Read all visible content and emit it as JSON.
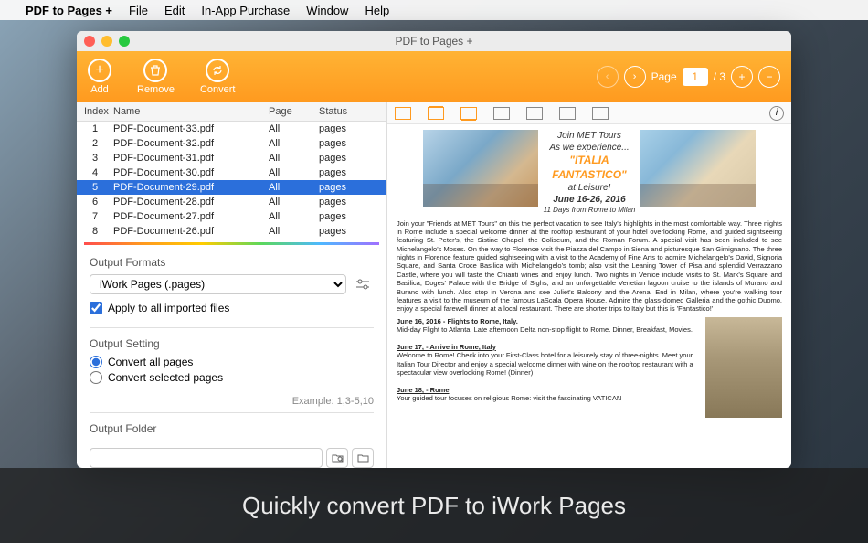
{
  "menubar": {
    "app": "PDF to Pages +",
    "items": [
      "File",
      "Edit",
      "In-App Purchase",
      "Window",
      "Help"
    ]
  },
  "window": {
    "title": "PDF to Pages +"
  },
  "toolbar": {
    "add": "Add",
    "remove": "Remove",
    "convert": "Convert"
  },
  "page_nav": {
    "label": "Page",
    "current": "1",
    "total": "/ 3"
  },
  "table": {
    "headers": {
      "index": "Index",
      "name": "Name",
      "page": "Page",
      "status": "Status"
    },
    "rows": [
      {
        "idx": "1",
        "name": "PDF-Document-33.pdf",
        "page": "All",
        "status": "pages"
      },
      {
        "idx": "2",
        "name": "PDF-Document-32.pdf",
        "page": "All",
        "status": "pages"
      },
      {
        "idx": "3",
        "name": "PDF-Document-31.pdf",
        "page": "All",
        "status": "pages"
      },
      {
        "idx": "4",
        "name": "PDF-Document-30.pdf",
        "page": "All",
        "status": "pages"
      },
      {
        "idx": "5",
        "name": "PDF-Document-29.pdf",
        "page": "All",
        "status": "pages"
      },
      {
        "idx": "6",
        "name": "PDF-Document-28.pdf",
        "page": "All",
        "status": "pages"
      },
      {
        "idx": "7",
        "name": "PDF-Document-27.pdf",
        "page": "All",
        "status": "pages"
      },
      {
        "idx": "8",
        "name": "PDF-Document-26.pdf",
        "page": "All",
        "status": "pages"
      }
    ],
    "selected": 4
  },
  "output_formats": {
    "title": "Output Formats",
    "selected": "iWork Pages (.pages)",
    "apply_all": "Apply to all imported files"
  },
  "output_setting": {
    "title": "Output Setting",
    "all": "Convert all pages",
    "selected": "Convert selected pages",
    "example": "Example: 1,3-5,10"
  },
  "output_folder": {
    "title": "Output Folder"
  },
  "preview": {
    "join": "Join MET Tours",
    "exp": "As we experience...",
    "italia": "\"ITALIA",
    "fantastico": "FANTASTICO\"",
    "leisure": "at Leisure!",
    "dates": "June 16-26, 2016",
    "days": "11 Days from Rome to Milan",
    "intro": "Join your \"Friends at MET Tours\" on this the perfect vacation to see Italy's highlights in the most comfortable way. Three nights in Rome include a special welcome dinner at the rooftop restaurant of your hotel overlooking Rome, and guided sightseeing featuring St. Peter's, the Sistine Chapel, the Coliseum, and the Roman Forum. A special visit has been included to see Michelangelo's Moses. On the way to Florence visit the Piazza del Campo in Siena and picturesque San Gimignano. The three nights in Florence feature guided sightseeing with a visit to the Academy of Fine Arts to admire Michelangelo's David, Signoria Square, and Santa Croce Basilica with Michelangelo's tomb; also visit the Leaning Tower of Pisa and splendid Verrazzano Castle, where you will taste the Chianti wines and enjoy lunch. Two nights in Venice include visits to St. Mark's Square and Basilica, Doges' Palace with the Bridge of Sighs, and an unforgettable Venetian lagoon cruise to the islands of Murano and Burano with lunch. Also stop in Verona and see Juliet's Balcony and the Arena. End in Milan, where you're walking tour features a visit to the museum of the famous LaScala Opera House. Admire the glass-domed Galleria and the gothic Duomo, enjoy a special farewell dinner at a local restaurant. There are shorter trips to Italy but this is 'Fantastico!'",
    "d1_title": "June 16, 2016 - Flights to Rome, Italy.",
    "d1_text": "Mid-day Flight to Atlanta, Late afternoon Delta non-stop flight to Rome. Dinner, Breakfast, Movies.",
    "d2_title": "June 17, - Arrive in Rome, Italy",
    "d2_text": "Welcome to Rome! Check into your First-Class hotel for a leisurely stay of three-nights. Meet your Italian Tour Director and enjoy a special welcome dinner with wine on the rooftop restaurant with a spectacular view overlooking Rome! (Dinner)",
    "d3_title": "June 18, - Rome",
    "d3_text": "Your guided tour focuses on religious Rome: visit the fascinating VATICAN"
  },
  "caption": "Quickly convert PDF to iWork Pages"
}
